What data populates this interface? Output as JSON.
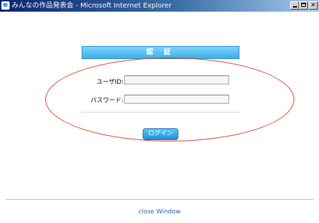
{
  "window": {
    "title": "みんなの作品発表会 - Microsoft Internet Explorer",
    "icon": "ie-logo-icon",
    "buttons": [
      "minimize",
      "maximize",
      "close"
    ]
  },
  "auth": {
    "header": "認 証",
    "userid_label": "ユーザID:",
    "userid_value": "",
    "password_label": "パスワード:",
    "password_value": "",
    "login_button": "ログイン"
  },
  "footer": {
    "close_link": "close Window"
  },
  "colors": {
    "accent": "#3bb0e8",
    "annotation": "#e03a1e",
    "link": "#2a5db0"
  }
}
